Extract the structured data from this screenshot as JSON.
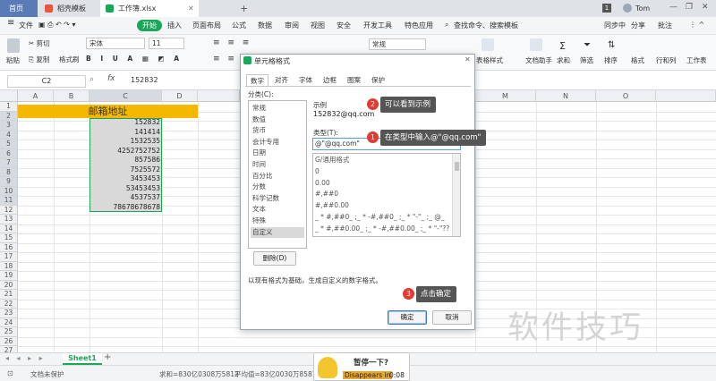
{
  "tabs": {
    "home": "首页",
    "template": "稻壳模板",
    "file": "工作簿.xlsx",
    "new": "+",
    "page_badge": "1",
    "user": "Tom"
  },
  "menu": {
    "file": "文件",
    "start": "开始",
    "insert": "插入",
    "page_layout": "页面布局",
    "formula": "公式",
    "data": "数据",
    "review": "审阅",
    "view": "视图",
    "security": "安全",
    "developer": "开发工具",
    "special": "特色应用",
    "search": "查找命令、搜索模板",
    "sync": "同步中",
    "share": "分享",
    "comment": "批注"
  },
  "ribbon": {
    "paste": "粘贴",
    "cut": "剪切",
    "copy": "复制",
    "format_painter": "格式刷",
    "font": "宋体",
    "font_size": "11",
    "merge": "合并居中",
    "wrap": "自动换行",
    "number_format": "常规",
    "table_style": "表格样式",
    "doc_helper": "文档助手",
    "sum": "求和",
    "filter": "筛选",
    "sort": "排序",
    "format": "格式",
    "rows_cols": "行和列",
    "sheet": "工作表"
  },
  "formula_bar": {
    "cell_ref": "C2",
    "fx": "fx",
    "value": "152832"
  },
  "columns": [
    "A",
    "B",
    "C",
    "D",
    "M",
    "N",
    "O"
  ],
  "rows": [
    "1",
    "2",
    "3",
    "4",
    "5",
    "6",
    "7",
    "8",
    "9",
    "10",
    "11",
    "12",
    "13",
    "14",
    "15",
    "16",
    "17",
    "18",
    "19",
    "20",
    "21",
    "22",
    "23",
    "24",
    "25",
    "26",
    "27"
  ],
  "header_cell": "邮箱地址",
  "cells": [
    "152832",
    "141414",
    "1532535",
    "4252752752",
    "857586",
    "7525572",
    "3453453",
    "53453453",
    "4537537",
    "78678678678"
  ],
  "dialog": {
    "title": "单元格格式",
    "tabs": [
      "数字",
      "对齐",
      "字体",
      "边框",
      "图案",
      "保护"
    ],
    "category_label": "分类(C):",
    "categories": [
      "常规",
      "数值",
      "货币",
      "会计专用",
      "日期",
      "时间",
      "百分比",
      "分数",
      "科学记数",
      "文本",
      "特殊",
      "自定义"
    ],
    "sample_label": "示例",
    "sample_value": "152832@qq.com",
    "type_label": "类型(T):",
    "type_value": "@\"@qq.com\"",
    "type_list": [
      "G/通用格式",
      "0",
      "0.00",
      "#,##0",
      "#,##0.00",
      "_ * #,##0_ ;_ * -#,##0_ ;_ * \"-\"_ ;_ @_",
      "_ * #,##0.00_ ;_ * -#,##0.00_ ;_ * \"-\"??_ ;_ @_"
    ],
    "delete_button": "删除(D)",
    "hint": "以现有格式为基础，生成自定义的数字格式。",
    "ok": "确定",
    "cancel": "取消"
  },
  "callouts": {
    "step1_num": "1",
    "step1_text": "在类型中输入@\"@qq.com\"",
    "step2_num": "2",
    "step2_text": "可以看到示例",
    "step3_num": "3",
    "step3_text": "点击确定"
  },
  "sheet_tab": "Sheet1",
  "status": {
    "protect": "文档未保护",
    "sum": "求和=830亿0308万5812",
    "avg": "平均值=83亿0030万8581"
  },
  "popup": {
    "title": "暂停一下?",
    "disappears": "Disappears in",
    "time": "0:08"
  },
  "watermark": "软件技巧",
  "colors": {
    "accent_green": "#1aa75a",
    "header_yellow": "#f5b800",
    "selection_gray": "#d9d9d9",
    "callout_bg": "#555555",
    "badge_red": "#e03c31"
  }
}
